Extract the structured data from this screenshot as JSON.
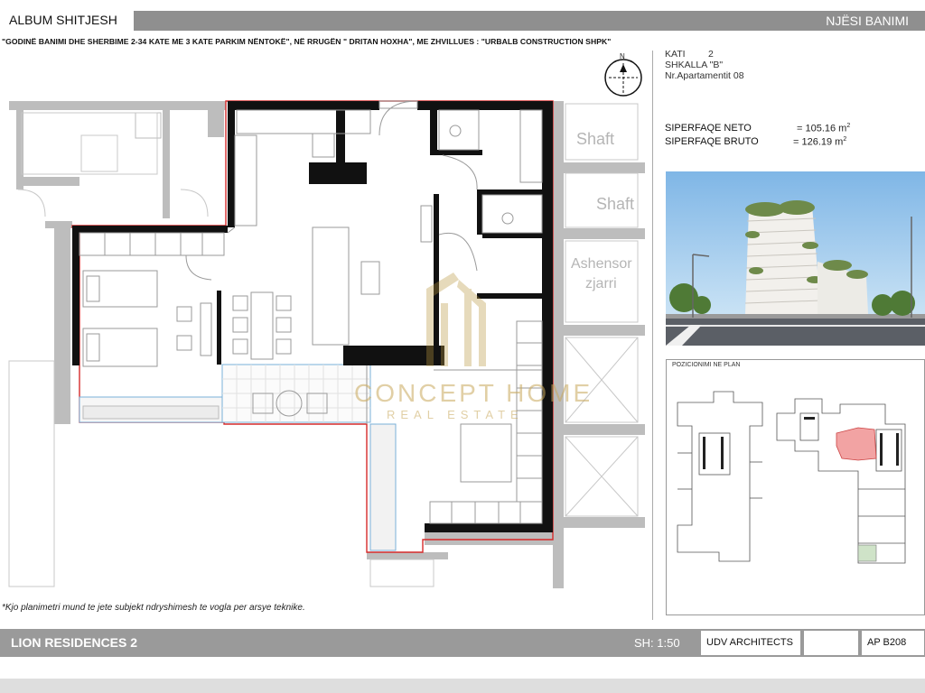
{
  "header": {
    "album": "ALBUM SHITJESH",
    "unit": "NJËSI BANIMI",
    "subtitle": "\"GODINË BANIMI DHE SHERBIME 2-34 KATE  ME 3 KATE PARKIM NËNTOKË\", NË RRUGËN \" DRITAN HOXHA\", ME  ZHVILLUES : \"URBALB CONSTRUCTION SHPK\""
  },
  "info": {
    "kati_label": "KATI",
    "kati_value": "2",
    "shkalla": "SHKALLA \"B\"",
    "apartment": "Nr.Apartamentit  08",
    "neto_label": "SIPERFAQE NETO",
    "neto_value": "= 105.16 m",
    "bruto_label": "SIPERFAQE BRUTO",
    "bruto_value": "= 126.19 m",
    "unit_sup": "2"
  },
  "plan": {
    "shaft1": "Shaft",
    "shaft2": "Shaft",
    "elevator1": "Ashensor",
    "elevator2": "zjarri",
    "watermark1": "CONCEPT HOME",
    "watermark2": "REAL ESTATE",
    "compass": "N",
    "note": "*Kjo planimetri mund te jete subjekt ndryshimesh te vogla per arsye teknike."
  },
  "position": {
    "title": "POZICIONIMI NE PLAN"
  },
  "footer": {
    "project": "LION  RESIDENCES 2",
    "scale": "SH: 1:50",
    "architect": "UDV ARCHITECTS",
    "code": "AP  B208"
  },
  "colors": {
    "bar": "#9a9a9a",
    "wall": "#111111",
    "outline": "#d62a2a",
    "highlight": "#f2a3a3"
  }
}
